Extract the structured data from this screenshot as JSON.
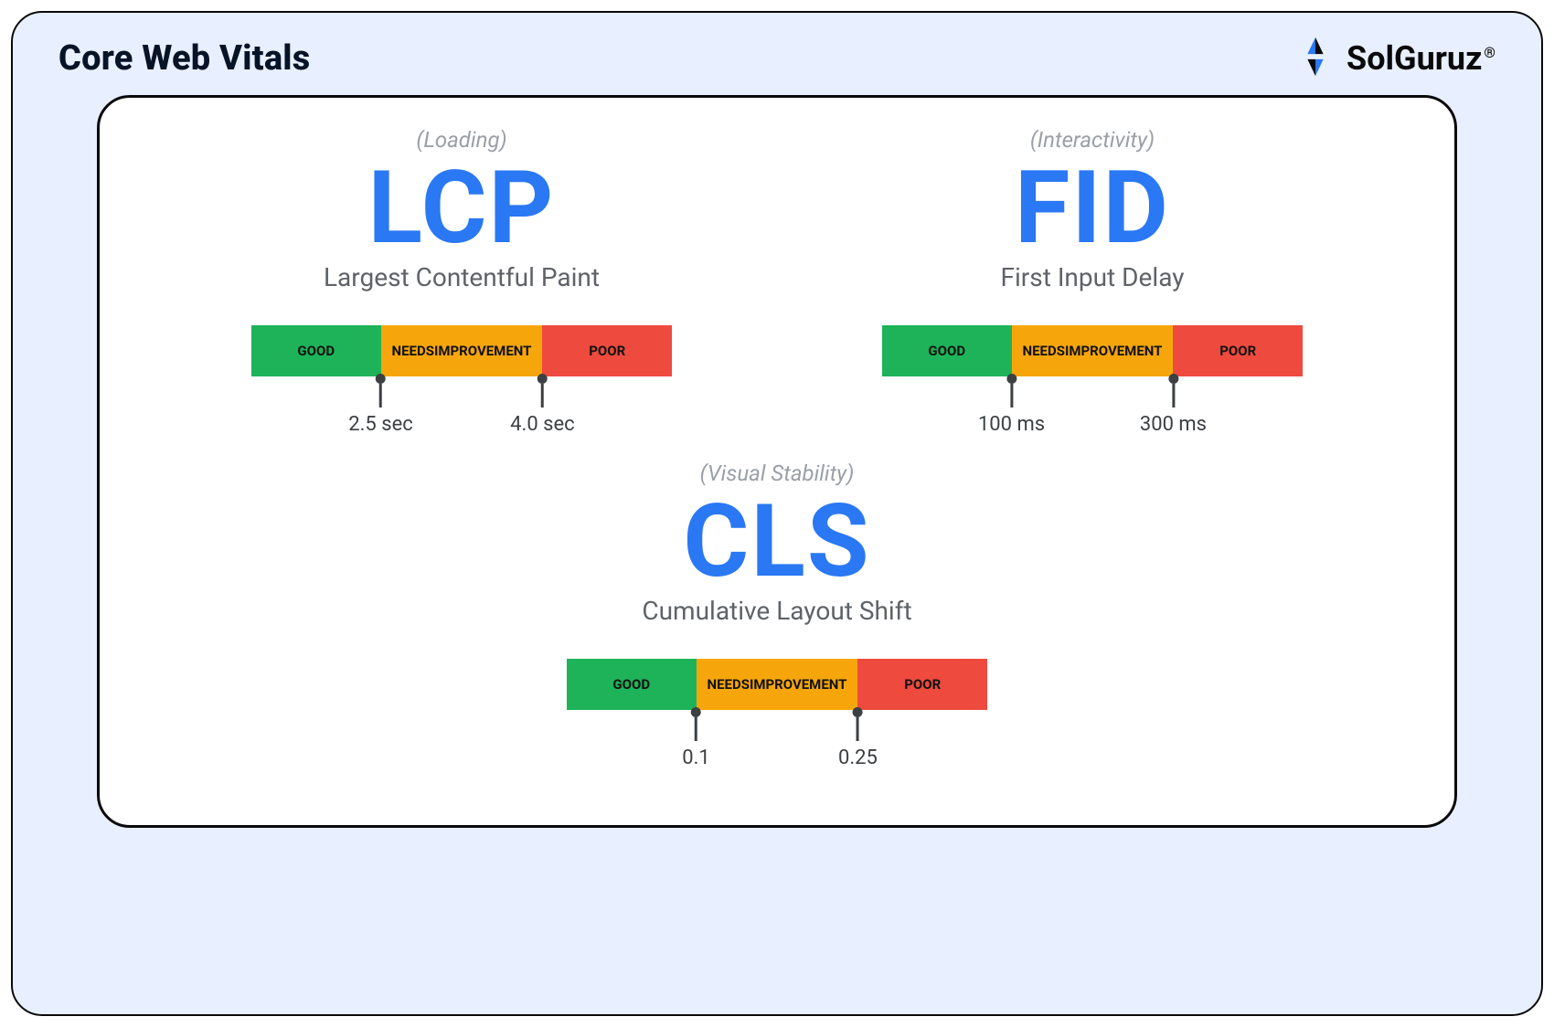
{
  "header": {
    "title": "Core Web Vitals",
    "brand_name": "SolGuruz",
    "brand_trademark": "®"
  },
  "colors": {
    "good": "#1eb359",
    "needs": "#f6a60b",
    "poor": "#ee4a3e",
    "accent": "#2a78f3"
  },
  "segment_labels": {
    "good": "GOOD",
    "needs_line1": "NEEDS",
    "needs_line2": "IMPROVEMENT",
    "poor": "POOR"
  },
  "metrics": [
    {
      "category": "(Loading)",
      "abbr": "LCP",
      "full": "Largest Contentful Paint",
      "threshold_low": "2.5 sec",
      "threshold_high": "4.0 sec"
    },
    {
      "category": "(Interactivity)",
      "abbr": "FID",
      "full": "First Input Delay",
      "threshold_low": "100 ms",
      "threshold_high": "300 ms"
    },
    {
      "category": "(Visual Stability)",
      "abbr": "CLS",
      "full": "Cumulative Layout Shift",
      "threshold_low": "0.1",
      "threshold_high": "0.25"
    }
  ]
}
